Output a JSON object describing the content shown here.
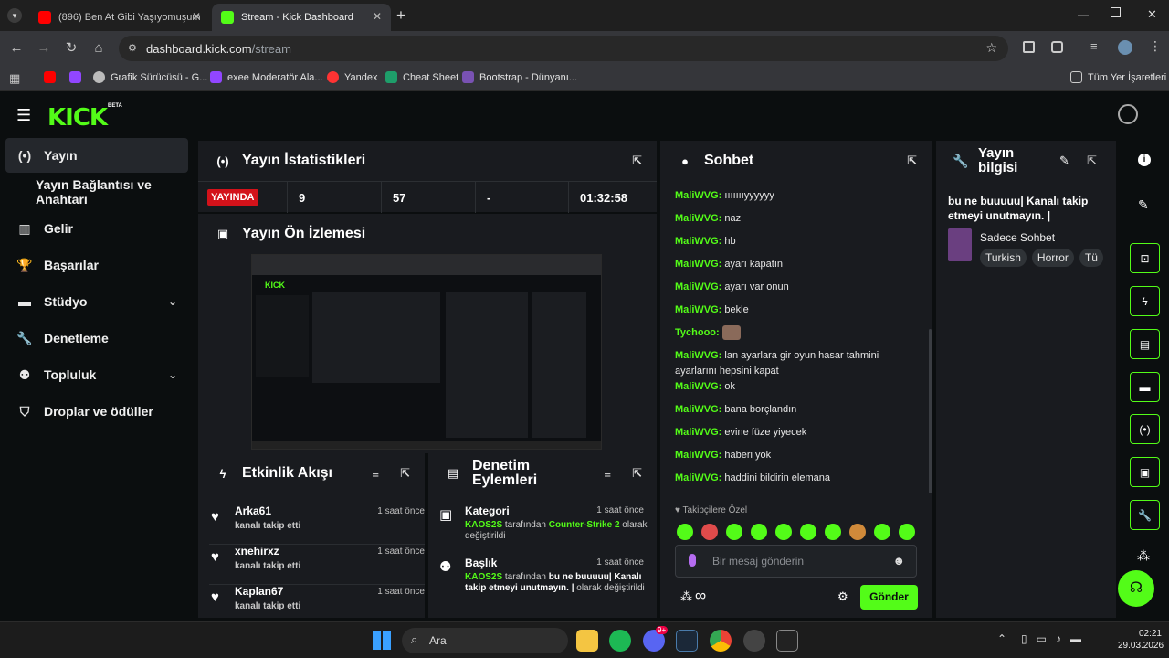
{
  "browser": {
    "tabs": [
      {
        "title": "(896) Ben At Gibi Yaşıyomuşum",
        "icon": "youtube-icon"
      },
      {
        "title": "Stream - Kick Dashboard",
        "icon": "kick-icon"
      }
    ],
    "url_host": "dashboard.kick.com",
    "url_path": "/stream",
    "bookmarks": [
      "Grafik Sürücüsü - G...",
      "exee Moderatör Ala...",
      "Yandex",
      "Cheat Sheet",
      "Bootstrap - Dünyanı..."
    ],
    "all_bookmarks": "Tüm Yer İşaretleri"
  },
  "app": {
    "logo": "KICK",
    "logo_badge": "BETA",
    "sidebar": [
      {
        "label": "Yayın",
        "icon": "broadcast-icon",
        "active": true
      },
      {
        "label": "Yayın Bağlantısı ve Anahtarı",
        "icon": ""
      },
      {
        "label": "Gelir",
        "icon": "chart-icon"
      },
      {
        "label": "Başarılar",
        "icon": "trophy-icon"
      },
      {
        "label": "Stüdyo",
        "icon": "studio-icon",
        "expandable": true
      },
      {
        "label": "Denetleme",
        "icon": "wrench-icon"
      },
      {
        "label": "Topluluk",
        "icon": "community-icon",
        "expandable": true
      },
      {
        "label": "Droplar ve ödüller",
        "icon": "gift-icon"
      }
    ]
  },
  "stats": {
    "title": "Yayın İstatistikleri",
    "live_badge": "YAYINDA",
    "viewers": "9",
    "followers": "57",
    "subs": "-",
    "duration": "01:32:58"
  },
  "preview": {
    "title": "Yayın Ön İzlemesi"
  },
  "activity": {
    "title": "Etkinlik Akışı",
    "events": [
      {
        "name": "Arka61",
        "text": "kanalı takip etti",
        "time": "1 saat önce"
      },
      {
        "name": "xnehirxz",
        "text": "kanalı takip etti",
        "time": "1 saat önce"
      },
      {
        "name": "Kaplan67",
        "text": "kanalı takip etti",
        "time": "1 saat önce"
      }
    ]
  },
  "moderation": {
    "title": "Denetim Eylemleri",
    "items": [
      {
        "title": "Kategori",
        "time": "1 saat önce",
        "user": "KAOS2S",
        "mid": " tarafından ",
        "value": "Counter-Strike 2",
        "end": " olarak değiştirildi"
      },
      {
        "title": "Başlık",
        "time": "1 saat önce",
        "user": "KAOS2S",
        "mid": " tarafından ",
        "value": "bu ne buuuuu| Kanalı takip etmeyi unutmayın. |",
        "end": " olarak değiştirildi"
      }
    ]
  },
  "chat": {
    "title": "Sohbet",
    "messages": [
      {
        "user": "MaliWVG",
        "text": "ıııııııyyyyyy",
        "color": "#53fc18"
      },
      {
        "user": "MaliWVG",
        "text": "naz",
        "color": "#53fc18"
      },
      {
        "user": "MaliWVG",
        "text": "hb",
        "color": "#53fc18"
      },
      {
        "user": "MaliWVG",
        "text": "ayarı kapatın",
        "color": "#53fc18"
      },
      {
        "user": "MaliWVG",
        "text": "ayarı var onun",
        "color": "#53fc18"
      },
      {
        "user": "MaliWVG",
        "text": "bekle",
        "color": "#53fc18"
      },
      {
        "user": "Tychooo",
        "text": "",
        "color": "#53fc18"
      },
      {
        "user": "MaliWVG",
        "text": "lan ayarlara gir oyun hasar tahmini ayarlarını hepsini kapat",
        "color": "#53fc18"
      },
      {
        "user": "MaliWVG",
        "text": "ok",
        "color": "#53fc18"
      },
      {
        "user": "MaliWVG",
        "text": "bana borçlandın",
        "color": "#53fc18"
      },
      {
        "user": "MaliWVG",
        "text": "evine füze yiyecek",
        "color": "#53fc18"
      },
      {
        "user": "MaliWVG",
        "text": "haberi yok",
        "color": "#53fc18"
      },
      {
        "user": "MaliWVG",
        "text": "haddini bildirin elemana",
        "color": "#53fc18"
      }
    ],
    "followers_only": "Takipçilere Özel",
    "input_placeholder": "Bir mesaj gönderin",
    "send_label": "Gönder",
    "infinity": "∞"
  },
  "info": {
    "title_line1": "Yayın",
    "title_line2": "bilgisi",
    "stream_title": "bu ne buuuuu| Kanalı takip etmeyi unutmayın. |",
    "category": "Sadece Sohbet",
    "tags": [
      "Turkish",
      "Horror",
      "Tü"
    ]
  },
  "taskbar": {
    "search": "Ara",
    "time": "02:21",
    "date": "29.03.2026",
    "discord_badge": "9+"
  },
  "colors": {
    "accent": "#53fc18",
    "live": "#d3121a",
    "panel": "#191b1f"
  }
}
